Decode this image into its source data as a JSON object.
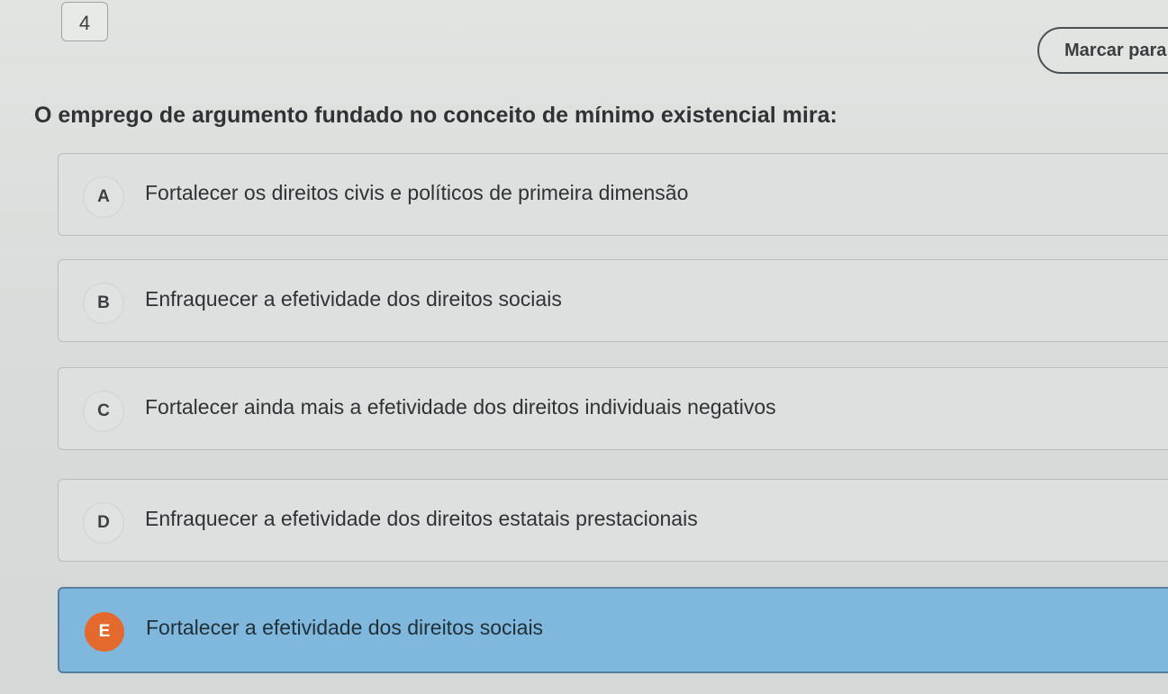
{
  "question": {
    "number": "4",
    "mark_label": "Marcar para",
    "text": "O emprego de argumento fundado no conceito de mínimo existencial mira:"
  },
  "options": [
    {
      "letter": "A",
      "text": "Fortalecer os direitos civis e políticos de primeira dimensão",
      "selected": false
    },
    {
      "letter": "B",
      "text": "Enfraquecer a efetividade dos direitos sociais",
      "selected": false
    },
    {
      "letter": "C",
      "text": "Fortalecer ainda mais a efetividade dos direitos individuais negativos",
      "selected": false
    },
    {
      "letter": "D",
      "text": "Enfraquecer a efetividade dos direitos estatais prestacionais",
      "selected": false
    },
    {
      "letter": "E",
      "text": "Fortalecer a efetividade dos direitos sociais",
      "selected": true
    }
  ],
  "colors": {
    "selected_option_background": "#7fb8dc",
    "selected_letter_badge": "#e36a2c",
    "page_background": "#d8dbd9"
  }
}
